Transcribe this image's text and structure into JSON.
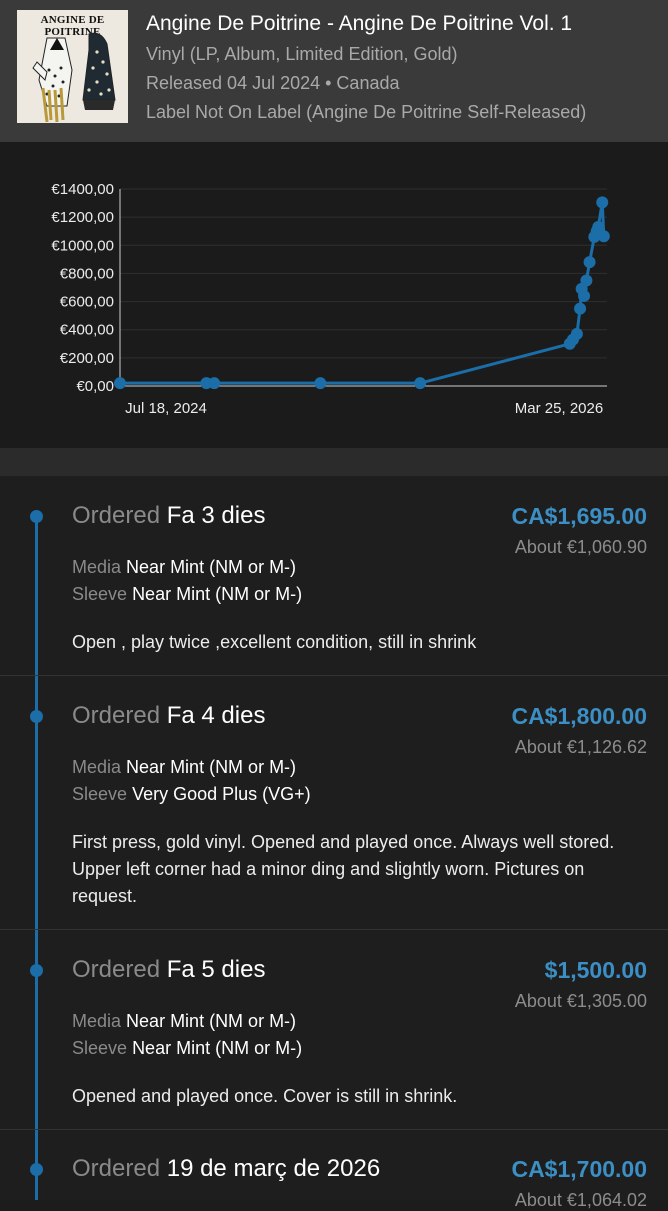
{
  "release": {
    "cover_text": "ANGINE DE POITRINE",
    "title": "Angine De Poitrine - Angine De Poitrine Vol. 1",
    "format": "Vinyl (LP, Album, Limited Edition, Gold)",
    "released_line": "Released 04 Jul 2024  • Canada",
    "label_line": "Label Not On Label (Angine De Poitrine Self-Released)"
  },
  "chart_data": {
    "type": "line",
    "title": "",
    "xlabel": "",
    "ylabel": "",
    "x_tick_labels": [
      "Jul 18, 2024",
      "Mar 25, 2026"
    ],
    "y_tick_labels": [
      "€0,00",
      "€200,00",
      "€400,00",
      "€600,00",
      "€800,00",
      "€1000,00",
      "€1200,00",
      "€1400,00"
    ],
    "ylim": [
      0,
      1400
    ],
    "xlim": [
      "2024-07-18",
      "2026-03-25"
    ],
    "grid": true,
    "color": "#1b6ea7",
    "series": [
      {
        "x": [
          "2024-07-18",
          "2024-11-04",
          "2024-11-14",
          "2025-03-28",
          "2025-08-01",
          "2026-02-06",
          "2026-02-10",
          "2026-02-15",
          "2026-02-19",
          "2026-02-21",
          "2026-02-24",
          "2026-02-27",
          "2026-03-03",
          "2026-03-09",
          "2026-03-12",
          "2026-03-14",
          "2026-03-19",
          "2026-03-21"
        ],
        "values": [
          20,
          20,
          20,
          20,
          20,
          300,
          330,
          370,
          550,
          690,
          640,
          750,
          880,
          1060,
          1100,
          1130,
          1305,
          1064
        ]
      }
    ]
  },
  "listings": [
    {
      "ordered_label": "Ordered",
      "when": "Fa 3 dies",
      "price": "CA$1,695.00",
      "about": "About €1,060.90",
      "media_label": "Media",
      "media": "Near Mint (NM or M-)",
      "sleeve_label": "Sleeve",
      "sleeve": "Near Mint (NM or M-)",
      "comment": "Open , play twice ,excellent condition, still in shrink"
    },
    {
      "ordered_label": "Ordered",
      "when": "Fa 4 dies",
      "price": "CA$1,800.00",
      "about": "About €1,126.62",
      "media_label": "Media",
      "media": "Near Mint (NM or M-)",
      "sleeve_label": "Sleeve",
      "sleeve": "Very Good Plus (VG+)",
      "comment": "First press, gold vinyl. Opened and played once. Always well stored. Upper left corner had a minor ding and slightly worn. Pictures on request."
    },
    {
      "ordered_label": "Ordered",
      "when": "Fa 5 dies",
      "price": "$1,500.00",
      "about": "About €1,305.00",
      "media_label": "Media",
      "media": "Near Mint (NM or M-)",
      "sleeve_label": "Sleeve",
      "sleeve": "Near Mint (NM or M-)",
      "comment": "Opened and played once.  Cover is still in shrink."
    },
    {
      "ordered_label": "Ordered",
      "when": "19 de març de 2026",
      "price": "CA$1,700.00",
      "about": "About €1,064.02"
    }
  ],
  "colors": {
    "accent": "#1b6ea7",
    "price": "#3b8fc4",
    "header_bg": "#3a3a3a"
  }
}
